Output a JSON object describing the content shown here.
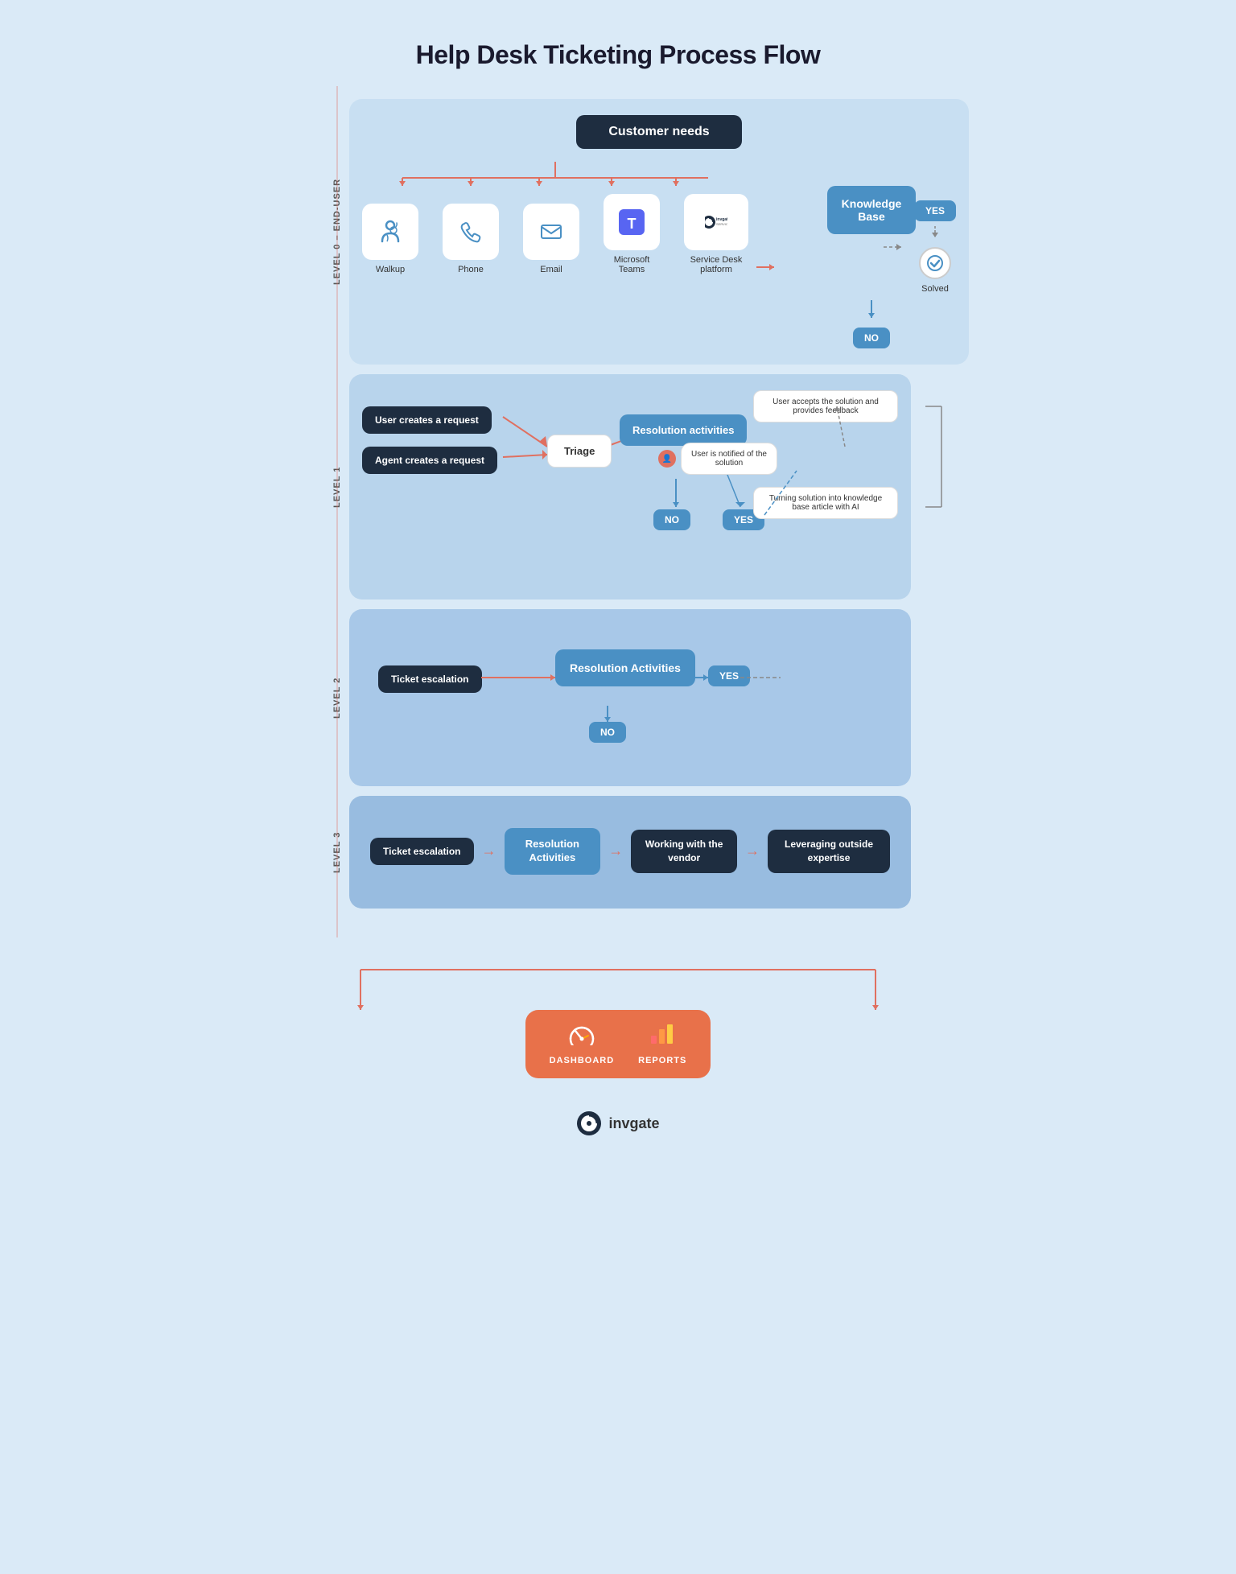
{
  "title": "Help Desk Ticketing Process Flow",
  "levels": {
    "level0": "LEVEL 0 – END-USER",
    "level1": "LEVEL 1",
    "level2": "LEVEL 2",
    "level3": "LEVEL 3"
  },
  "nodes": {
    "customerNeeds": "Customer needs",
    "channels": [
      {
        "label": "Walkup",
        "icon": "👤"
      },
      {
        "label": "Phone",
        "icon": "📞"
      },
      {
        "label": "Email",
        "icon": "✉️"
      },
      {
        "label": "Microsoft Teams",
        "icon": "🟦"
      },
      {
        "label": "Service Desk platform",
        "icon": "🔵"
      }
    ],
    "knowledgeBase": "Knowledge Base",
    "yes": "YES",
    "no": "NO",
    "solved": "Solved",
    "userCreates": "User creates a request",
    "agentCreates": "Agent creates a request",
    "triage": "Triage",
    "resolutionActivities1": "Resolution activities",
    "userNotified": "User is notified of the solution",
    "userAccepts": "User accepts the solution and provides feedback",
    "turningSolution": "Turning solution into knowledge base article with AI",
    "ticketEscalation2": "Ticket escalation",
    "resolutionActivities2": "Resolution Activities",
    "ticketEscalation3": "Ticket escalation",
    "resolutionActivities3": "Resolution Activities",
    "workingWithVendor": "Working with the vendor",
    "leveragingExpertise": "Leveraging outside expertise",
    "dashboard": "DASHBOARD",
    "reports": "REPORTS",
    "invgate": "invgate"
  }
}
